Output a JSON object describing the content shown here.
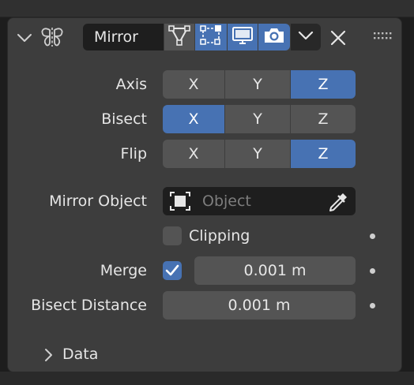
{
  "modifier": {
    "name": "Mirror",
    "icons": {
      "collapse": "chevron-down-icon",
      "type": "mirror-modifier-icon",
      "edit_mode": "edit-mode-icon",
      "on_cage": "on-cage-icon",
      "realtime": "display-monitor-icon",
      "render": "camera-icon",
      "menu": "chevron-down-icon",
      "delete": "close-icon",
      "drag": "drag-handle-icon"
    },
    "toggles": {
      "edit_mode": false,
      "on_cage": true,
      "realtime": true,
      "render": true
    }
  },
  "axis": {
    "label": "Axis",
    "options": [
      "X",
      "Y",
      "Z"
    ],
    "active": [
      false,
      false,
      true
    ]
  },
  "bisect": {
    "label": "Bisect",
    "options": [
      "X",
      "Y",
      "Z"
    ],
    "active": [
      true,
      false,
      false
    ]
  },
  "flip": {
    "label": "Flip",
    "options": [
      "X",
      "Y",
      "Z"
    ],
    "active": [
      false,
      false,
      true
    ]
  },
  "mirror_object": {
    "label": "Mirror Object",
    "placeholder": "Object",
    "icon": "object-icon",
    "picker_icon": "eyedropper-icon"
  },
  "clipping": {
    "label": "Clipping",
    "checked": false
  },
  "merge": {
    "label": "Merge",
    "checked": true,
    "value": "0.001 m"
  },
  "bisect_distance": {
    "label": "Bisect Distance",
    "value": "0.001 m"
  },
  "data_section": {
    "label": "Data",
    "icon": "chevron-right-icon"
  },
  "colors": {
    "accent": "#4772b3",
    "panel": "#3d3d3d",
    "button": "#545454",
    "field_dark": "#1e1e1e"
  }
}
